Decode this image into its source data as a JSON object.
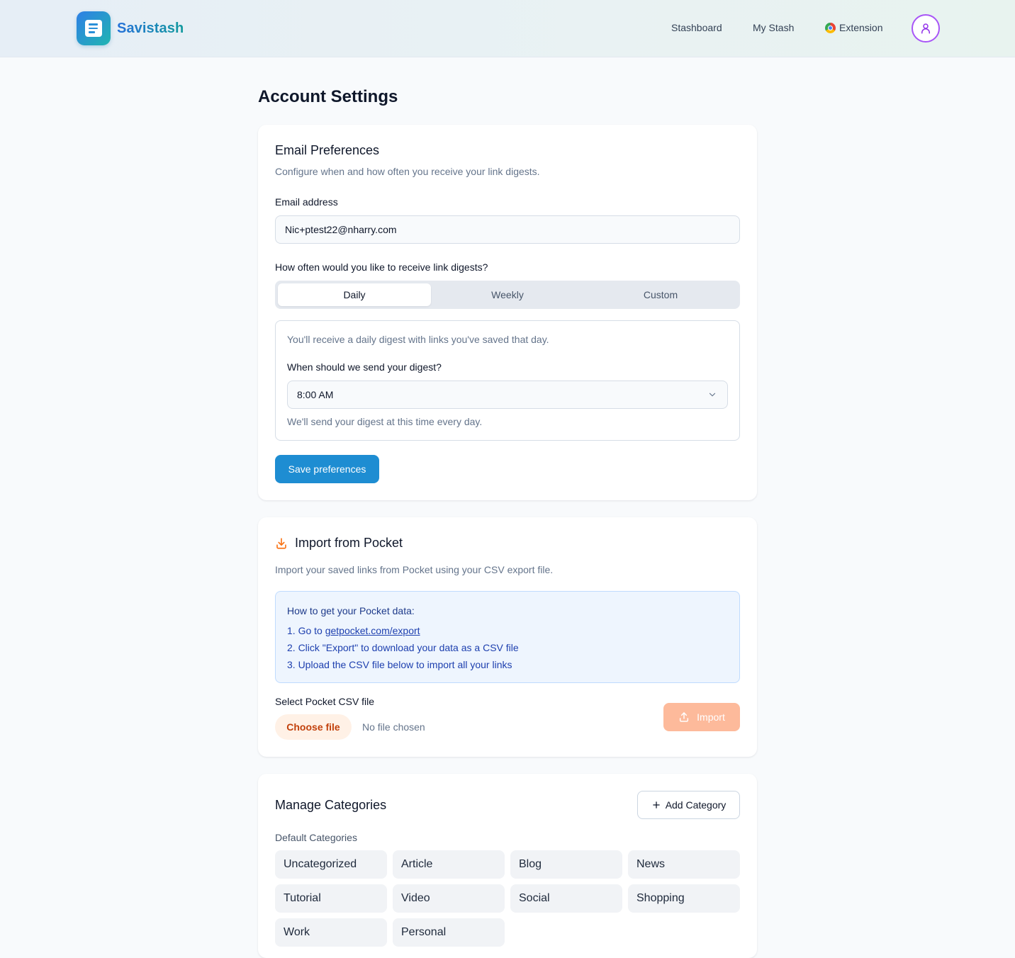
{
  "app": {
    "name": "Savistash",
    "brand_gradient": [
      "#2f7fe6",
      "#20b5b1"
    ]
  },
  "nav": {
    "stashboard": "Stashboard",
    "my_stash": "My Stash",
    "extension": "Extension",
    "extension_icon": "chrome-icon",
    "avatar_icon": "user-icon"
  },
  "page": {
    "title": "Account Settings"
  },
  "email_prefs": {
    "title": "Email Preferences",
    "description": "Configure when and how often you receive your link digests.",
    "email_label": "Email address",
    "email_value": "Nic+ptest22@nharry.com",
    "frequency_label": "How often would you like to receive link digests?",
    "frequency_options": [
      "Daily",
      "Weekly",
      "Custom"
    ],
    "frequency_selected": "Daily",
    "daily_description": "You'll receive a daily digest with links you've saved that day.",
    "time_label": "When should we send your digest?",
    "time_value": "8:00 AM",
    "time_help": "We'll send your digest at this time every day.",
    "save_label": "Save preferences",
    "accent_color": "#1e8dd2"
  },
  "pocket": {
    "title": "Import from Pocket",
    "icon": "download-icon",
    "description": "Import your saved links from Pocket using your CSV export file.",
    "howto_title": "How to get your Pocket data:",
    "step1_prefix": "1. Go to ",
    "step1_link": "getpocket.com/export",
    "step2": "2. Click \"Export\" to download your data as a CSV file",
    "step3": "3. Upload the CSV file below to import all your links",
    "file_label": "Select Pocket CSV file",
    "choose_file": "Choose file",
    "no_file": "No file chosen",
    "import_label": "Import",
    "accent_color": "#f97316"
  },
  "categories": {
    "title": "Manage Categories",
    "add_label": "Add Category",
    "default_label": "Default Categories",
    "items": [
      "Uncategorized",
      "Article",
      "Blog",
      "News",
      "Tutorial",
      "Video",
      "Social",
      "Shopping",
      "Work",
      "Personal"
    ]
  }
}
